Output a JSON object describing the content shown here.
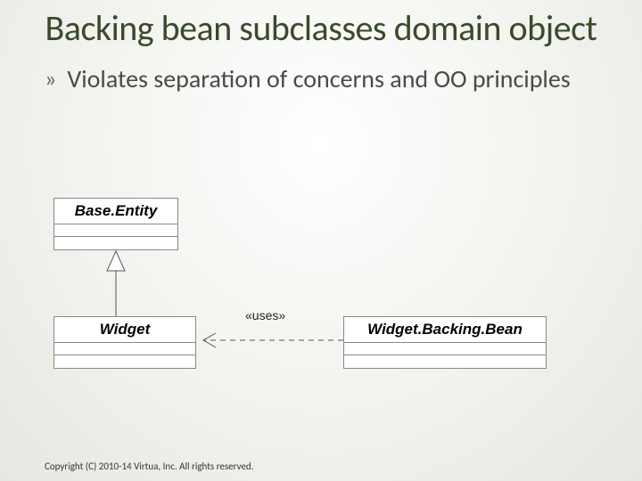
{
  "title": "Backing bean subclasses domain object",
  "bullet": {
    "marker": "»",
    "text": "Violates separation of concerns and OO principles"
  },
  "uml": {
    "base_entity": "Base.Entity",
    "widget": "Widget",
    "widget_backing_bean": "Widget.Backing.Bean",
    "uses_label": "«uses»"
  },
  "footer": "Copyright (C) 2010-14 Virtua, Inc. All rights reserved."
}
